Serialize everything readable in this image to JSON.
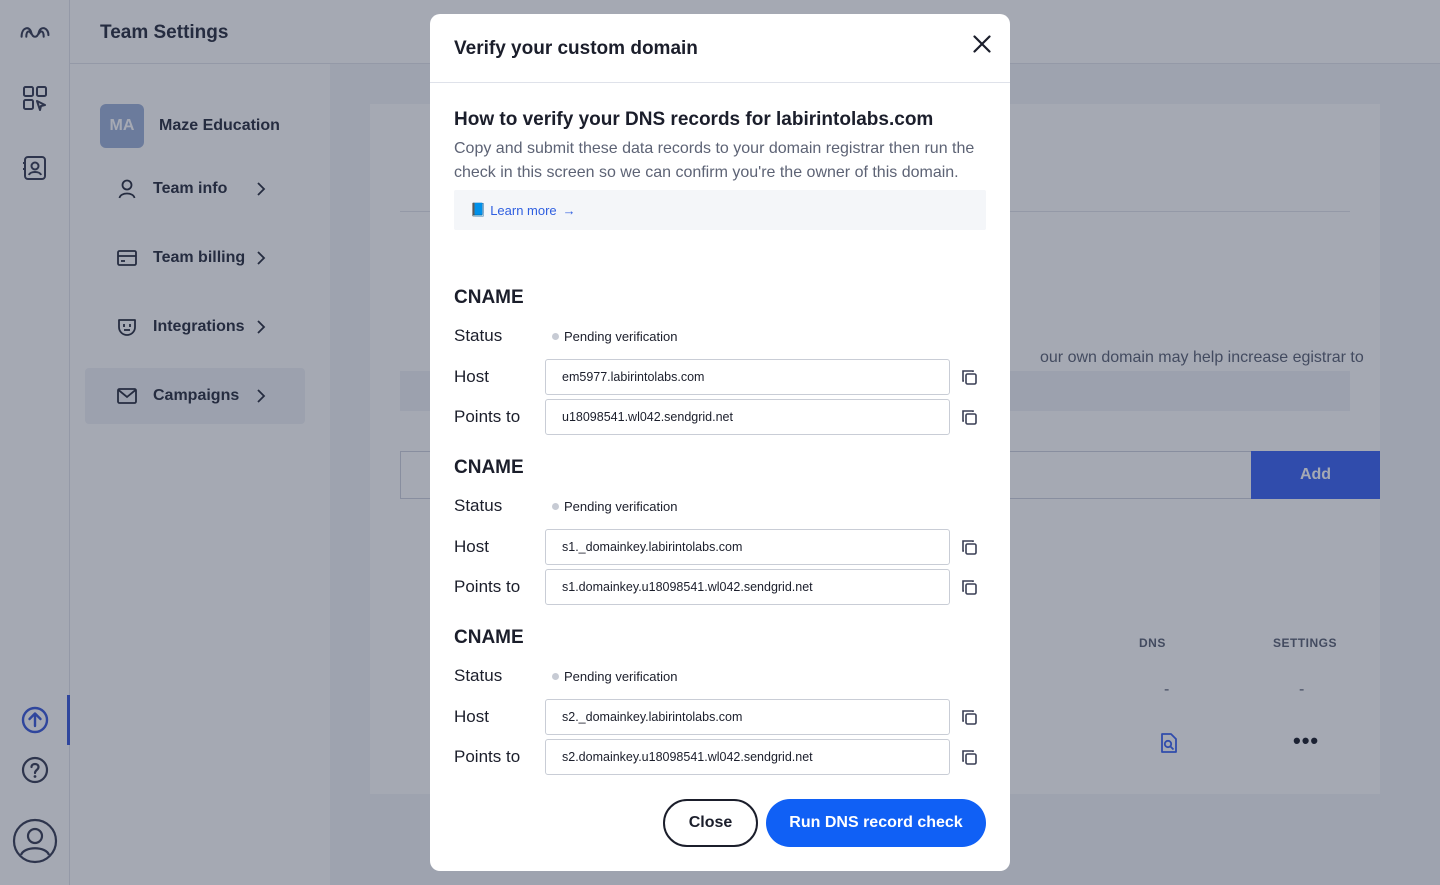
{
  "app": {
    "page_title": "Team Settings"
  },
  "team": {
    "initials": "MA",
    "name": "Maze Education"
  },
  "sidenav": {
    "items": [
      {
        "label": "Team info",
        "icon": "user-icon",
        "active": false
      },
      {
        "label": "Team billing",
        "icon": "credit-card-icon",
        "active": false
      },
      {
        "label": "Integrations",
        "icon": "plug-icon",
        "active": false
      },
      {
        "label": "Campaigns",
        "icon": "envelope-icon",
        "active": true
      }
    ]
  },
  "background_card": {
    "description": "our own domain may help increase egistrar to verify.",
    "add_label": "Add",
    "columns": {
      "dns": "DNS",
      "settings": "SETTINGS"
    },
    "row1": {
      "dns": "-",
      "settings": "-"
    },
    "row2": {
      "more": "•••"
    }
  },
  "modal": {
    "title": "Verify your custom domain",
    "heading": "How to verify your DNS records for labirintolabs.com",
    "intro": "Copy and submit these data records to your domain registrar then run the check in this screen so we can confirm you're the owner of this domain.",
    "learn_more": "Learn more",
    "learn_more_arrow": "→",
    "learn_more_icon": "📘",
    "labels": {
      "status": "Status",
      "host": "Host",
      "points_to": "Points to"
    },
    "records": [
      {
        "type": "CNAME",
        "status": "Pending verification",
        "host": "em5977.labirintolabs.com",
        "points_to": "u18098541.wl042.sendgrid.net"
      },
      {
        "type": "CNAME",
        "status": "Pending verification",
        "host": "s1._domainkey.labirintolabs.com",
        "points_to": "s1.domainkey.u18098541.wl042.sendgrid.net"
      },
      {
        "type": "CNAME",
        "status": "Pending verification",
        "host": "s2._domainkey.labirintolabs.com",
        "points_to": "s2.domainkey.u18098541.wl042.sendgrid.net"
      }
    ],
    "close_label": "Close",
    "run_label": "Run DNS record check"
  },
  "colors": {
    "primary": "#1060f5",
    "add_button": "#3d64f4",
    "status_pending": "#c7cbd4",
    "overlay": "rgba(30,39,66,0.40)"
  }
}
